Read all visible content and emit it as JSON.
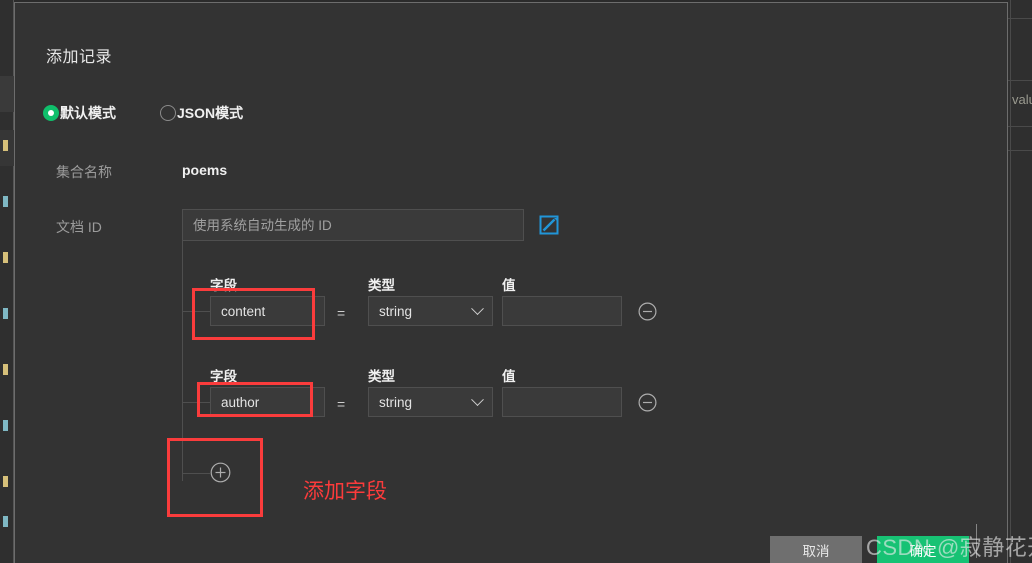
{
  "dialog": {
    "title": "添加记录",
    "modes": [
      {
        "label": "默认模式",
        "selected": true
      },
      {
        "label": "JSON模式",
        "selected": false
      }
    ],
    "collection": {
      "label": "集合名称",
      "value": "poems"
    },
    "document_id": {
      "label": "文档 ID",
      "placeholder": "使用系统自动生成的 ID",
      "value": "",
      "edit_icon": "edit-pencil-icon"
    },
    "columns": {
      "field": "字段",
      "type": "类型",
      "value": "值"
    },
    "equals": "=",
    "fields": [
      {
        "name": "content",
        "type": "string",
        "value": ""
      },
      {
        "name": "author",
        "type": "string",
        "value": ""
      }
    ],
    "add_field_icon": "plus-circle-icon",
    "remove_icon": "minus-circle-icon",
    "chevron_icon": "chevron-down-icon",
    "footer": {
      "cancel": "取消",
      "confirm": "确定"
    }
  },
  "annotations": {
    "add_field_text": "添加字段",
    "color": "#fb3b3b"
  },
  "watermark": {
    "text": "CSDN @寂静花开"
  },
  "background": {
    "column_header": "value"
  },
  "colors": {
    "dialog_bg": "#333333",
    "page_bg": "#2b2b2b",
    "accent_green": "#17c274",
    "radio_green": "#0fbf6b",
    "edit_blue": "#2196d8",
    "annotation_red": "#fb3b3b"
  }
}
